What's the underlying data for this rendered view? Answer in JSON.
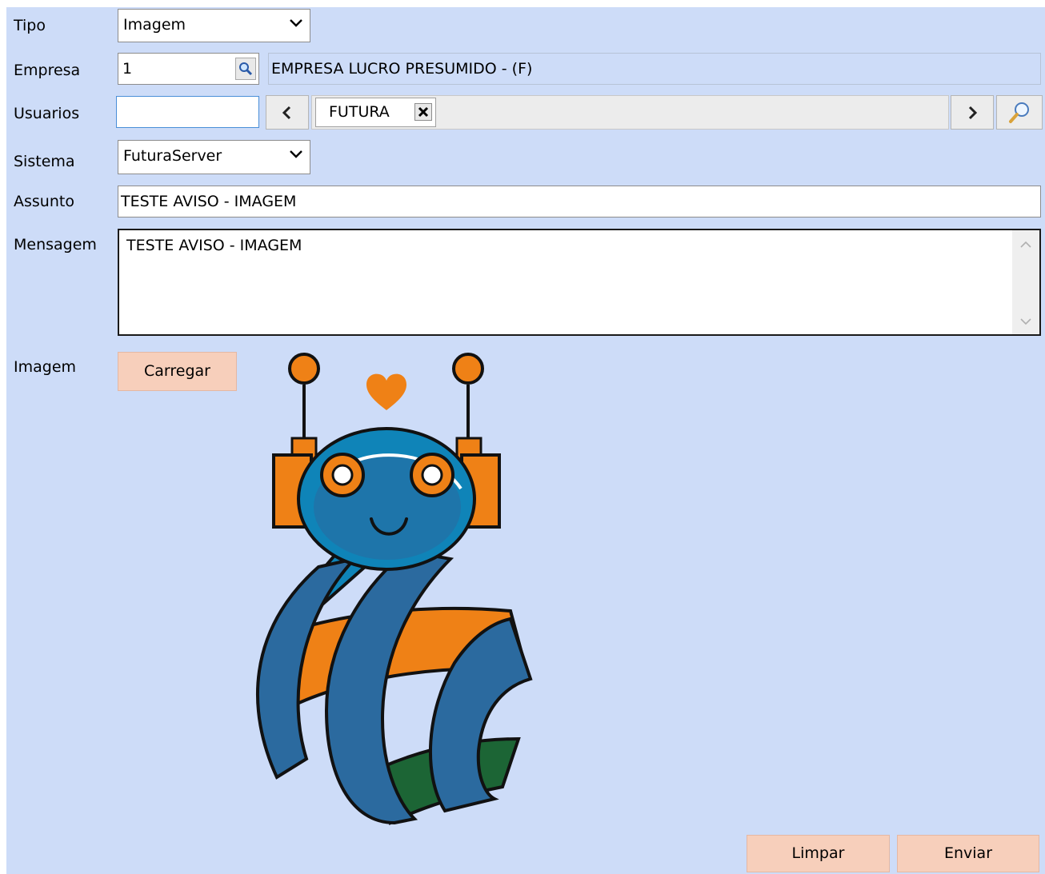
{
  "labels": {
    "tipo": "Tipo",
    "empresa": "Empresa",
    "usuarios": "Usuarios",
    "sistema": "Sistema",
    "assunto": "Assunto",
    "mensagem": "Mensagem",
    "imagem": "Imagem"
  },
  "tipo": {
    "value": "Imagem"
  },
  "empresa": {
    "code": "1",
    "name": "EMPRESA LUCRO PRESUMIDO - (F)"
  },
  "usuarios": {
    "input_value": "",
    "tags": [
      {
        "label": "FUTURA"
      }
    ]
  },
  "sistema": {
    "value": "FuturaServer"
  },
  "assunto": {
    "value": "TESTE AVISO - IMAGEM"
  },
  "mensagem": {
    "value": "TESTE AVISO - IMAGEM"
  },
  "buttons": {
    "carregar": "Carregar",
    "limpar": "Limpar",
    "enviar": "Enviar"
  },
  "colors": {
    "background": "#cddcf8",
    "button": "#f7cfbb",
    "robot_blue": "#2b6a9f",
    "robot_orange": "#ef8116",
    "robot_green": "#1c6535"
  },
  "icons": [
    "chevron-down-icon",
    "search-icon",
    "chevron-left-icon",
    "chevron-right-icon",
    "close-icon",
    "magnifier-icon",
    "scroll-up-icon",
    "scroll-down-icon"
  ]
}
